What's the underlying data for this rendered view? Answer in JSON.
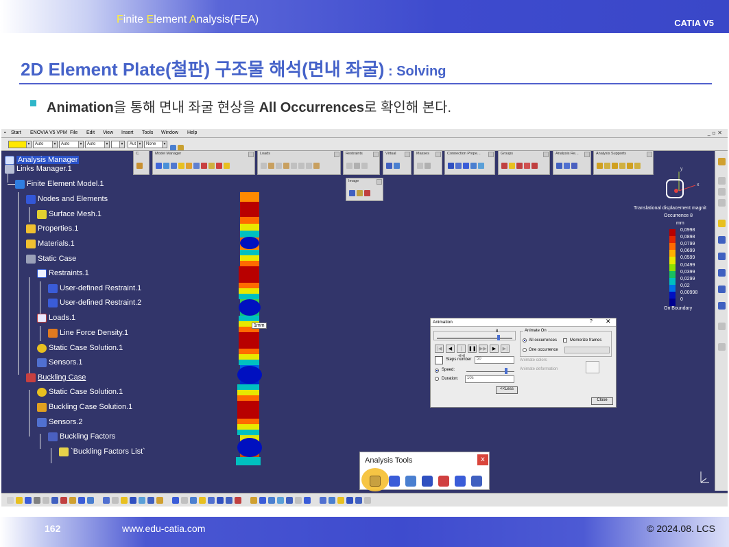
{
  "header": {
    "title_parts": [
      "F",
      "inite ",
      "E",
      "lement ",
      "A",
      "nalysis(FEA)"
    ],
    "brand": "CATIA V5"
  },
  "slide": {
    "title": "2D Element Plate(철판) 구조물 해석(면내 좌굴)",
    "title_suffix": " : Solving",
    "bullet_parts": [
      "Animation",
      "을 통해 면내 좌굴 현상을 ",
      "All Occurrences",
      "로 확인해 본다."
    ],
    "bullet_color": "#2fb6c9",
    "title_color": "#4663c9"
  },
  "catia": {
    "menu": [
      "Start",
      "ENOVIA V5 VPM",
      "File",
      "Edit",
      "View",
      "Insert",
      "Tools",
      "Window",
      "Help"
    ],
    "selectors": [
      "",
      "Auto",
      "Auto",
      "Auto",
      "",
      "Aut",
      "None"
    ],
    "tree": [
      {
        "label": "Analysis Manager",
        "icon": "analysis-manager-icon"
      },
      {
        "label": "Links Manager.1",
        "icon": "links-manager-icon"
      },
      {
        "label": "Finite Element Model.1",
        "icon": "finite-element-model-icon"
      },
      {
        "label": "Nodes and Elements",
        "icon": "nodes-elements-icon"
      },
      {
        "label": "Surface Mesh.1",
        "icon": "surface-mesh-icon"
      },
      {
        "label": "Properties.1",
        "icon": "folder-icon"
      },
      {
        "label": "Materials.1",
        "icon": "folder-icon"
      },
      {
        "label": "Static Case",
        "icon": "static-case-icon"
      },
      {
        "label": "Restraints.1",
        "icon": "restraints-icon"
      },
      {
        "label": "User-defined Restraint.1",
        "icon": "user-restraint-icon"
      },
      {
        "label": "User-defined Restraint.2",
        "icon": "user-restraint-icon"
      },
      {
        "label": "Loads.1",
        "icon": "loads-icon"
      },
      {
        "label": "Line Force Density.1",
        "icon": "line-force-icon"
      },
      {
        "label": "Static Case Solution.1",
        "icon": "solution-icon"
      },
      {
        "label": "Sensors.1",
        "icon": "sensors-icon"
      },
      {
        "label": "Buckling Case",
        "icon": "buckling-case-icon"
      },
      {
        "label": "Static Case Solution.1",
        "icon": "solution-icon"
      },
      {
        "label": "Buckling Case Solution.1",
        "icon": "buckling-solution-icon"
      },
      {
        "label": "Sensors.2",
        "icon": "sensors-icon"
      },
      {
        "label": "Buckling Factors",
        "icon": "buckling-factors-icon"
      },
      {
        "label": "`Buckling Factors List`",
        "icon": "list-icon"
      }
    ],
    "palettes": [
      "C.",
      "Model Manager",
      "Loads",
      "Restraints",
      "Virtual",
      "Masses",
      "Connection Prope...",
      "Groups",
      "Analysis Re...",
      "Analysis Supports",
      "Image"
    ],
    "mesh_label": "1mm",
    "legend": {
      "title": "Translational displacement magnit",
      "occurrence": "Occurrence 8",
      "unit": "mm",
      "values": [
        "0,0998",
        "0,0898",
        "0,0799",
        "0,0699",
        "0,0599",
        "0,0499",
        "0,0399",
        "0,0299",
        "0,02",
        "0,00998",
        "0"
      ],
      "colors": [
        "#b80000",
        "#e42600",
        "#ff6a00",
        "#ffb000",
        "#e8e800",
        "#8ee000",
        "#18c060",
        "#00c0c0",
        "#0070e8",
        "#0010c0",
        "#000090"
      ],
      "footer": "On Boundary"
    },
    "animation_dialog": {
      "title": "Animation",
      "help": "?",
      "close_x": "✕",
      "frame_value": "8",
      "player_buttons": [
        "|◀",
        "◀",
        "|◀◀",
        "❚❚",
        "▶▶|",
        "▶",
        "▶|"
      ],
      "steps_label": "Steps number",
      "steps_value": "50",
      "animate_colors": "Animate colors",
      "animate_deformation": "Animate deformation",
      "speed_label": "Speed:",
      "duration_label": "Duration:",
      "duration_value": "10s",
      "less_button": "<<Less",
      "close_button": "Close",
      "animate_on_title": "Animate On",
      "all_occurrences": "All occurrences",
      "memorize_frames": "Memorize frames",
      "one_occurrence": "One occurrence"
    },
    "analysis_tools": {
      "title": "Analysis Tools",
      "close": "x",
      "highlight_color": "#f5c23a"
    }
  },
  "footer": {
    "page": "162",
    "url": "www.edu-catia.com",
    "copyright": "© 2024.08. LCS"
  }
}
